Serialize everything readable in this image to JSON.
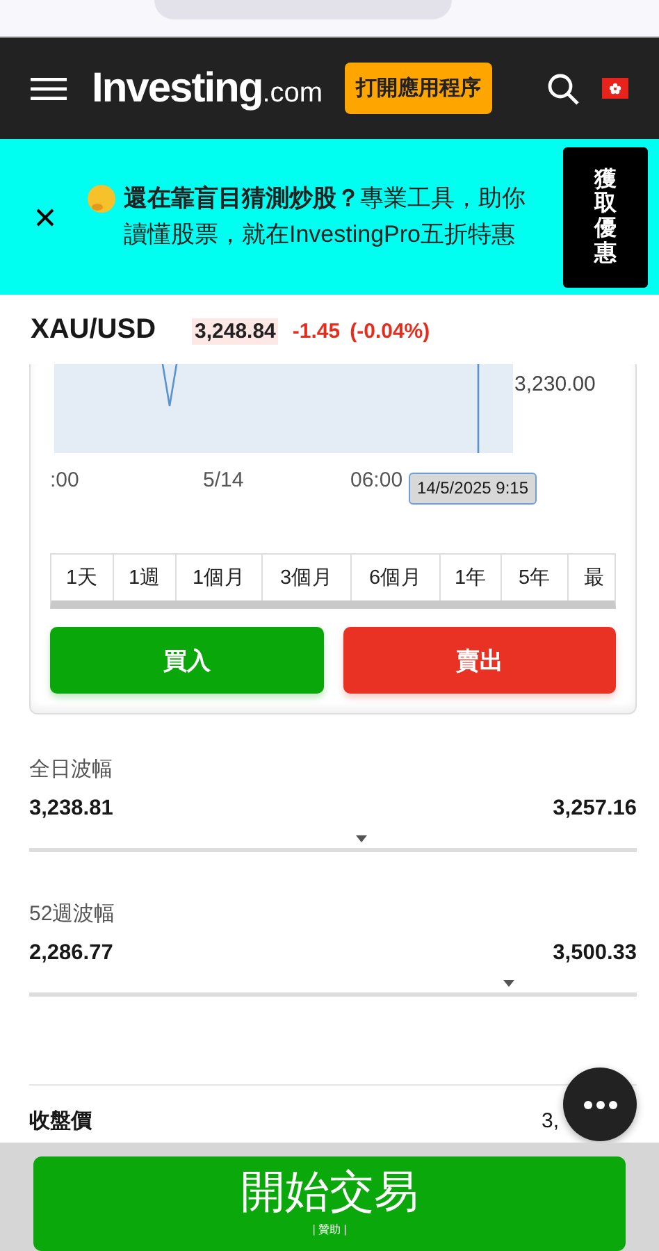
{
  "header": {
    "logo": {
      "name": "Investing",
      "suffix": ".com"
    },
    "app_button": "打開應用程序"
  },
  "promo": {
    "text": "**還在靠盲目猜測炒股？**專業工具，助你讀懂股票，就在InvestingPro五折特惠",
    "cta": "獲取優惠"
  },
  "instrument": {
    "symbol": "XAU/USD",
    "price": "3,248.84",
    "change": "-1.45",
    "change_pct": "(-0.04%)"
  },
  "chart": {
    "y_label": "3,230.00",
    "x_labels": [
      ":00",
      "5/14",
      "06:00"
    ],
    "crosshair_label": "14/5/2025 9:15"
  },
  "periods": [
    {
      "label": "1天",
      "selected": false
    },
    {
      "label": "1週",
      "selected": false
    },
    {
      "label": "1個月",
      "selected": false
    },
    {
      "label": "3個月",
      "selected": false
    },
    {
      "label": "6個月",
      "selected": false
    },
    {
      "label": "1年",
      "selected": false
    },
    {
      "label": "5年",
      "selected": false
    },
    {
      "label": "最",
      "selected": false
    }
  ],
  "actions": {
    "buy": "買入",
    "sell": "賣出"
  },
  "ranges": [
    {
      "title": "全日波幅",
      "low": "3,238.81",
      "high": "3,257.16",
      "level": 0.547
    },
    {
      "title": "52週波幅",
      "low": "2,286.77",
      "high": "3,500.33",
      "level": 0.79
    }
  ],
  "stats": [
    {
      "label": "收盤價",
      "value": "3,"
    }
  ],
  "footer": {
    "button": "開始交易",
    "sponsor": "| 贊助 |"
  }
}
